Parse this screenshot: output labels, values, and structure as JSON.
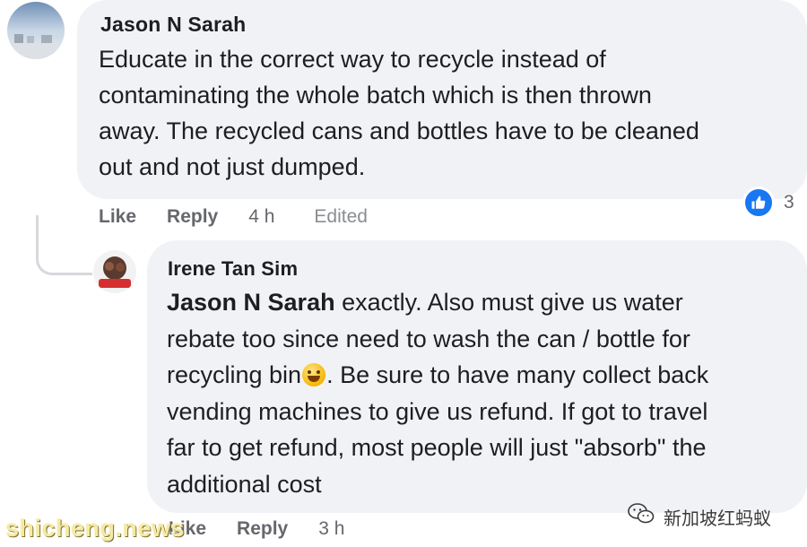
{
  "comment": {
    "author": "Jason N Sarah",
    "lines": [
      "Educate in the correct way to recycle instead of",
      "contaminating the whole batch which is then thrown",
      "away. The recycled cans and bottles have to be cleaned",
      "out and not just dumped."
    ],
    "actions": {
      "like": "Like",
      "reply": "Reply",
      "time": "4 h",
      "edited": "Edited"
    },
    "reaction_count": "3",
    "reaction_icon": "thumbs-up-icon"
  },
  "reply": {
    "author": "Irene Tan Sim",
    "mention": "Jason N Sarah",
    "line1_rest": " exactly. Also must give us water",
    "line2": "rebate too since need to wash the can / bottle for",
    "line3_before_emoji": "recycling bin",
    "emoji": "grinning-sweat-emoji",
    "line3_after_emoji": ". Be sure to have many collect back",
    "line4": "vending machines to give us refund. If got to travel",
    "line5": "far to get refund, most people will just \"absorb\" the",
    "line6": "additional cost",
    "actions": {
      "like": "Like",
      "reply": "Reply",
      "time": "3 h"
    }
  },
  "watermarks": {
    "left": "shicheng.news",
    "right": "新加坡红蚂蚁",
    "right_icon": "wechat-icon"
  },
  "colors": {
    "bubble": "#f0f2f5",
    "like_blue": "#1877f2",
    "meta_gray": "#65676b"
  }
}
